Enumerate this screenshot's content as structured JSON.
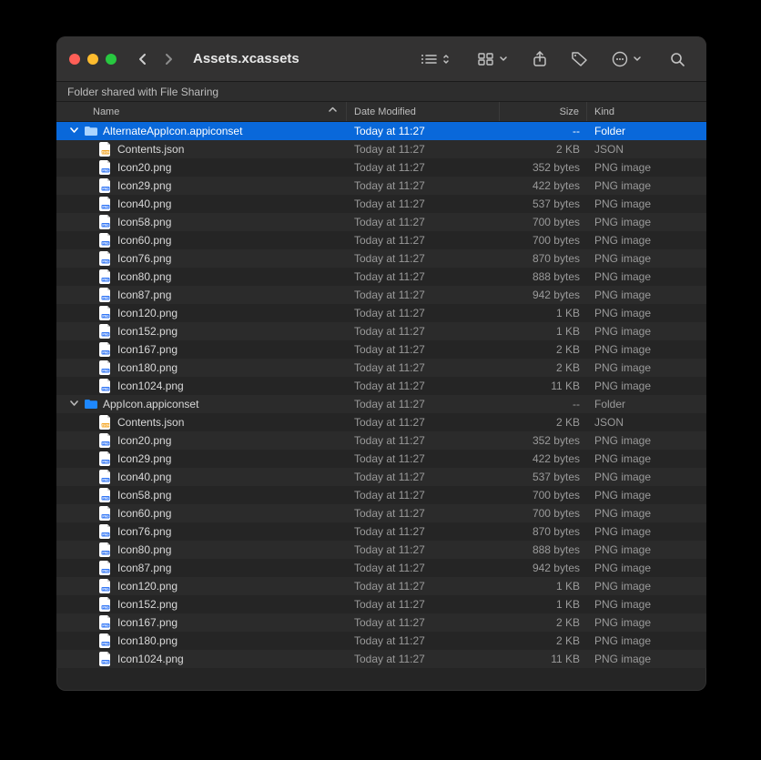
{
  "window": {
    "title": "Assets.xcassets",
    "info_message": "Folder shared with File Sharing"
  },
  "columns": {
    "name": "Name",
    "date": "Date Modified",
    "size": "Size",
    "kind": "Kind"
  },
  "rows": [
    {
      "depth": 0,
      "expand": "open",
      "icon": "folder",
      "name": "AlternateAppIcon.appiconset",
      "date": "Today at 11:27",
      "size": "--",
      "kind": "Folder",
      "selected": true
    },
    {
      "depth": 1,
      "expand": "none",
      "icon": "json",
      "name": "Contents.json",
      "date": "Today at 11:27",
      "size": "2 KB",
      "kind": "JSON"
    },
    {
      "depth": 1,
      "expand": "none",
      "icon": "png",
      "name": "Icon20.png",
      "date": "Today at 11:27",
      "size": "352 bytes",
      "kind": "PNG image"
    },
    {
      "depth": 1,
      "expand": "none",
      "icon": "png",
      "name": "Icon29.png",
      "date": "Today at 11:27",
      "size": "422 bytes",
      "kind": "PNG image"
    },
    {
      "depth": 1,
      "expand": "none",
      "icon": "png",
      "name": "Icon40.png",
      "date": "Today at 11:27",
      "size": "537 bytes",
      "kind": "PNG image"
    },
    {
      "depth": 1,
      "expand": "none",
      "icon": "png",
      "name": "Icon58.png",
      "date": "Today at 11:27",
      "size": "700 bytes",
      "kind": "PNG image"
    },
    {
      "depth": 1,
      "expand": "none",
      "icon": "png",
      "name": "Icon60.png",
      "date": "Today at 11:27",
      "size": "700 bytes",
      "kind": "PNG image"
    },
    {
      "depth": 1,
      "expand": "none",
      "icon": "png",
      "name": "Icon76.png",
      "date": "Today at 11:27",
      "size": "870 bytes",
      "kind": "PNG image"
    },
    {
      "depth": 1,
      "expand": "none",
      "icon": "png",
      "name": "Icon80.png",
      "date": "Today at 11:27",
      "size": "888 bytes",
      "kind": "PNG image"
    },
    {
      "depth": 1,
      "expand": "none",
      "icon": "png",
      "name": "Icon87.png",
      "date": "Today at 11:27",
      "size": "942 bytes",
      "kind": "PNG image"
    },
    {
      "depth": 1,
      "expand": "none",
      "icon": "png",
      "name": "Icon120.png",
      "date": "Today at 11:27",
      "size": "1 KB",
      "kind": "PNG image"
    },
    {
      "depth": 1,
      "expand": "none",
      "icon": "png",
      "name": "Icon152.png",
      "date": "Today at 11:27",
      "size": "1 KB",
      "kind": "PNG image"
    },
    {
      "depth": 1,
      "expand": "none",
      "icon": "png",
      "name": "Icon167.png",
      "date": "Today at 11:27",
      "size": "2 KB",
      "kind": "PNG image"
    },
    {
      "depth": 1,
      "expand": "none",
      "icon": "png",
      "name": "Icon180.png",
      "date": "Today at 11:27",
      "size": "2 KB",
      "kind": "PNG image"
    },
    {
      "depth": 1,
      "expand": "none",
      "icon": "png",
      "name": "Icon1024.png",
      "date": "Today at 11:27",
      "size": "11 KB",
      "kind": "PNG image"
    },
    {
      "depth": 0,
      "expand": "open",
      "icon": "folder",
      "name": "AppIcon.appiconset",
      "date": "Today at 11:27",
      "size": "--",
      "kind": "Folder"
    },
    {
      "depth": 1,
      "expand": "none",
      "icon": "json",
      "name": "Contents.json",
      "date": "Today at 11:27",
      "size": "2 KB",
      "kind": "JSON"
    },
    {
      "depth": 1,
      "expand": "none",
      "icon": "png",
      "name": "Icon20.png",
      "date": "Today at 11:27",
      "size": "352 bytes",
      "kind": "PNG image"
    },
    {
      "depth": 1,
      "expand": "none",
      "icon": "png",
      "name": "Icon29.png",
      "date": "Today at 11:27",
      "size": "422 bytes",
      "kind": "PNG image"
    },
    {
      "depth": 1,
      "expand": "none",
      "icon": "png",
      "name": "Icon40.png",
      "date": "Today at 11:27",
      "size": "537 bytes",
      "kind": "PNG image"
    },
    {
      "depth": 1,
      "expand": "none",
      "icon": "png",
      "name": "Icon58.png",
      "date": "Today at 11:27",
      "size": "700 bytes",
      "kind": "PNG image"
    },
    {
      "depth": 1,
      "expand": "none",
      "icon": "png",
      "name": "Icon60.png",
      "date": "Today at 11:27",
      "size": "700 bytes",
      "kind": "PNG image"
    },
    {
      "depth": 1,
      "expand": "none",
      "icon": "png",
      "name": "Icon76.png",
      "date": "Today at 11:27",
      "size": "870 bytes",
      "kind": "PNG image"
    },
    {
      "depth": 1,
      "expand": "none",
      "icon": "png",
      "name": "Icon80.png",
      "date": "Today at 11:27",
      "size": "888 bytes",
      "kind": "PNG image"
    },
    {
      "depth": 1,
      "expand": "none",
      "icon": "png",
      "name": "Icon87.png",
      "date": "Today at 11:27",
      "size": "942 bytes",
      "kind": "PNG image"
    },
    {
      "depth": 1,
      "expand": "none",
      "icon": "png",
      "name": "Icon120.png",
      "date": "Today at 11:27",
      "size": "1 KB",
      "kind": "PNG image"
    },
    {
      "depth": 1,
      "expand": "none",
      "icon": "png",
      "name": "Icon152.png",
      "date": "Today at 11:27",
      "size": "1 KB",
      "kind": "PNG image"
    },
    {
      "depth": 1,
      "expand": "none",
      "icon": "png",
      "name": "Icon167.png",
      "date": "Today at 11:27",
      "size": "2 KB",
      "kind": "PNG image"
    },
    {
      "depth": 1,
      "expand": "none",
      "icon": "png",
      "name": "Icon180.png",
      "date": "Today at 11:27",
      "size": "2 KB",
      "kind": "PNG image"
    },
    {
      "depth": 1,
      "expand": "none",
      "icon": "png",
      "name": "Icon1024.png",
      "date": "Today at 11:27",
      "size": "11 KB",
      "kind": "PNG image"
    }
  ]
}
